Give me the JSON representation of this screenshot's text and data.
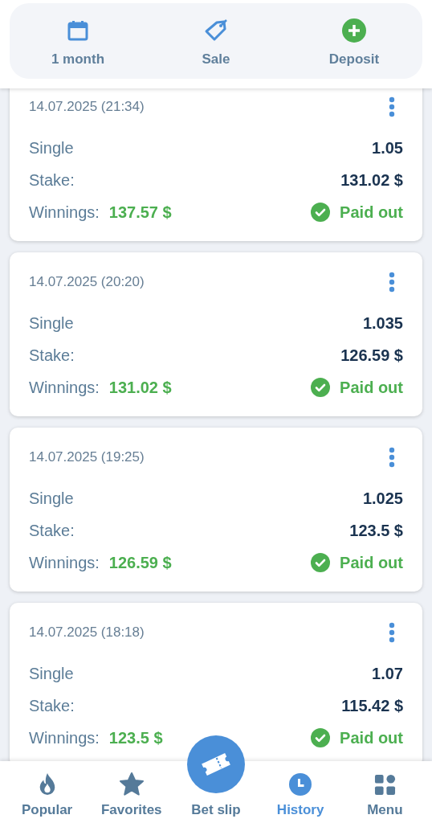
{
  "header_actions": [
    {
      "label": "1 month",
      "kind": "calendar"
    },
    {
      "label": "Sale",
      "kind": "tag"
    },
    {
      "label": "Deposit",
      "kind": "plus"
    }
  ],
  "bets": [
    {
      "date": "14.07.2025 (21:34)",
      "type": "Single",
      "odds": "1.05",
      "stake_label": "Stake:",
      "stake": "131.02 $",
      "winnings_label": "Winnings:",
      "winnings": "137.57 $",
      "status": "Paid out",
      "paid_out": true
    },
    {
      "date": "14.07.2025 (20:20)",
      "type": "Single",
      "odds": "1.035",
      "stake_label": "Stake:",
      "stake": "126.59 $",
      "winnings_label": "Winnings:",
      "winnings": "131.02 $",
      "status": "Paid out",
      "paid_out": true
    },
    {
      "date": "14.07.2025 (19:25)",
      "type": "Single",
      "odds": "1.025",
      "stake_label": "Stake:",
      "stake": "123.5 $",
      "winnings_label": "Winnings:",
      "winnings": "126.59 $",
      "status": "Paid out",
      "paid_out": true
    },
    {
      "date": "14.07.2025 (18:18)",
      "type": "Single",
      "odds": "1.07",
      "stake_label": "Stake:",
      "stake": "115.42 $",
      "winnings_label": "Winnings:",
      "winnings": "123.5 $",
      "status": "Paid out",
      "paid_out": true
    }
  ],
  "bottom_nav": [
    {
      "label": "Popular",
      "kind": "fire",
      "selected": false
    },
    {
      "label": "Favorites",
      "kind": "star",
      "selected": false
    },
    {
      "label": "Bet slip",
      "kind": "ticket",
      "selected": false
    },
    {
      "label": "History",
      "kind": "clock",
      "selected": true
    },
    {
      "label": "Menu",
      "kind": "grid",
      "selected": false
    }
  ]
}
